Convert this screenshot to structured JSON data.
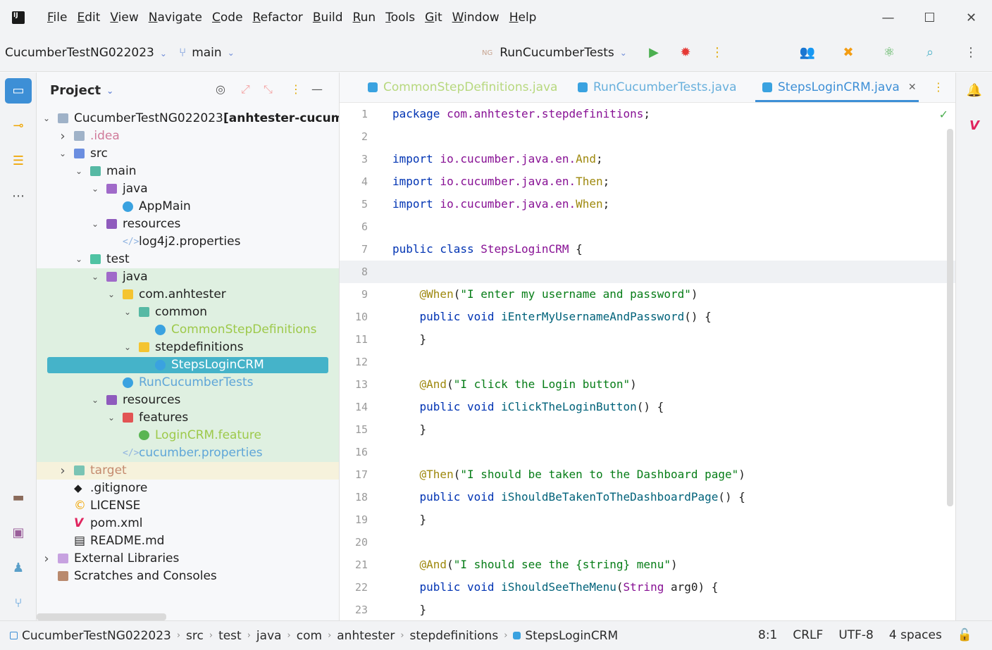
{
  "app": {
    "menu": [
      "File",
      "Edit",
      "View",
      "Navigate",
      "Code",
      "Refactor",
      "Build",
      "Run",
      "Tools",
      "Git",
      "Window",
      "Help"
    ],
    "window_controls": {
      "minimize": "—",
      "maximize": "☐",
      "close": "✕"
    }
  },
  "toolbar": {
    "project_name": "CucumberTestNG022023",
    "branch": "main",
    "run_config": "RunCucumberTests",
    "run_config_badge": "NG"
  },
  "project_panel": {
    "title": "Project",
    "tree": [
      {
        "label": "CucumberTestNG022023",
        "suffix": "[anhtester-cucum",
        "depth": 0,
        "arrow": "down",
        "icon": "folder",
        "style": ""
      },
      {
        "label": ".idea",
        "depth": 1,
        "arrow": "right",
        "icon": "folder",
        "style": "pink"
      },
      {
        "label": "src",
        "depth": 1,
        "arrow": "down",
        "icon": "folder-src",
        "style": ""
      },
      {
        "label": "main",
        "depth": 2,
        "arrow": "down",
        "icon": "folder-main",
        "style": ""
      },
      {
        "label": "java",
        "depth": 3,
        "arrow": "down",
        "icon": "folder-java",
        "style": ""
      },
      {
        "label": "AppMain",
        "depth": 4,
        "arrow": "",
        "icon": "class",
        "style": ""
      },
      {
        "label": "resources",
        "depth": 3,
        "arrow": "down",
        "icon": "folder-res",
        "style": ""
      },
      {
        "label": "log4j2.properties",
        "depth": 4,
        "arrow": "",
        "icon": "xml",
        "style": ""
      },
      {
        "label": "test",
        "depth": 2,
        "arrow": "down",
        "icon": "folder-test",
        "style": ""
      },
      {
        "label": "java",
        "depth": 3,
        "arrow": "down",
        "icon": "folder-java",
        "style": "",
        "bg": "green"
      },
      {
        "label": "com.anhtester",
        "depth": 4,
        "arrow": "down",
        "icon": "folder-pkg",
        "style": "",
        "bg": "green"
      },
      {
        "label": "common",
        "depth": 5,
        "arrow": "down",
        "icon": "folder-main",
        "style": "",
        "bg": "green"
      },
      {
        "label": "CommonStepDefinitions",
        "depth": 6,
        "arrow": "",
        "icon": "class",
        "style": "green",
        "bg": "green"
      },
      {
        "label": "stepdefinitions",
        "depth": 5,
        "arrow": "down",
        "icon": "folder-pkg",
        "style": "",
        "bg": "green"
      },
      {
        "label": "StepsLoginCRM",
        "depth": 6,
        "arrow": "",
        "icon": "class",
        "style": "",
        "bg": "green",
        "selected": true
      },
      {
        "label": "RunCucumberTests",
        "depth": 4,
        "arrow": "",
        "icon": "class",
        "style": "blue",
        "bg": "green"
      },
      {
        "label": "resources",
        "depth": 3,
        "arrow": "down",
        "icon": "folder-res",
        "style": "",
        "bg": "green"
      },
      {
        "label": "features",
        "depth": 4,
        "arrow": "down",
        "icon": "folder-feat",
        "style": "",
        "bg": "green"
      },
      {
        "label": "LoginCRM.feature",
        "depth": 5,
        "arrow": "",
        "icon": "cuke",
        "style": "green",
        "bg": "green"
      },
      {
        "label": "cucumber.properties",
        "depth": 4,
        "arrow": "",
        "icon": "xml",
        "style": "blue",
        "bg": "green"
      },
      {
        "label": "target",
        "depth": 1,
        "arrow": "right",
        "icon": "folder-target",
        "style": "target",
        "bg": "yellow"
      },
      {
        "label": ".gitignore",
        "depth": 1,
        "arrow": "",
        "icon": "git",
        "style": ""
      },
      {
        "label": "LICENSE",
        "depth": 1,
        "arrow": "",
        "icon": "license",
        "style": ""
      },
      {
        "label": "pom.xml",
        "depth": 1,
        "arrow": "",
        "icon": "maven",
        "style": ""
      },
      {
        "label": "README.md",
        "depth": 1,
        "arrow": "",
        "icon": "md",
        "style": ""
      },
      {
        "label": "External Libraries",
        "depth": 0,
        "arrow": "right",
        "icon": "folder-lib",
        "style": ""
      },
      {
        "label": "Scratches and Consoles",
        "depth": 0,
        "arrow": "",
        "icon": "scratch",
        "style": ""
      }
    ]
  },
  "editor": {
    "tabs": [
      {
        "label": "CommonStepDefinitions.java",
        "active": false
      },
      {
        "label": "RunCucumberTests.java",
        "active": false
      },
      {
        "label": "StepsLoginCRM.java",
        "active": true
      }
    ],
    "line_numbers": [
      "1",
      "2",
      "3",
      "4",
      "5",
      "6",
      "7",
      "8",
      "9",
      "10",
      "11",
      "12",
      "13",
      "14",
      "15",
      "16",
      "17",
      "18",
      "19",
      "20",
      "21",
      "22",
      "23"
    ],
    "code_lines": [
      [
        [
          "kw",
          "package "
        ],
        [
          "pkg",
          "com.anhtester.stepdefinitions"
        ],
        [
          "",
          "; "
        ]
      ],
      [],
      [
        [
          "kw",
          "import "
        ],
        [
          "pkg",
          "io.cucumber.java.en."
        ],
        [
          "ann",
          "And"
        ],
        [
          "",
          ";"
        ]
      ],
      [
        [
          "kw",
          "import "
        ],
        [
          "pkg",
          "io.cucumber.java.en."
        ],
        [
          "ann",
          "Then"
        ],
        [
          "",
          ";"
        ]
      ],
      [
        [
          "kw",
          "import "
        ],
        [
          "pkg",
          "io.cucumber.java.en."
        ],
        [
          "ann",
          "When"
        ],
        [
          "",
          ";"
        ]
      ],
      [],
      [
        [
          "kw",
          "public class "
        ],
        [
          "pkg",
          "StepsLoginCRM"
        ],
        [
          "",
          " {"
        ]
      ],
      [],
      [
        [
          "",
          "    "
        ],
        [
          "ann",
          "@When"
        ],
        [
          "",
          "("
        ],
        [
          "str",
          "\"I enter my username and password\""
        ],
        [
          "",
          ")"
        ]
      ],
      [
        [
          "",
          "    "
        ],
        [
          "kw",
          "public void "
        ],
        [
          "mth",
          "iEnterMyUsernameAndPassword"
        ],
        [
          "",
          "() {"
        ]
      ],
      [
        [
          "",
          "    }"
        ]
      ],
      [],
      [
        [
          "",
          "    "
        ],
        [
          "ann",
          "@And"
        ],
        [
          "",
          "("
        ],
        [
          "str",
          "\"I click the Login button\""
        ],
        [
          "",
          ")"
        ]
      ],
      [
        [
          "",
          "    "
        ],
        [
          "kw",
          "public void "
        ],
        [
          "mth",
          "iClickTheLoginButton"
        ],
        [
          "",
          "() {"
        ]
      ],
      [
        [
          "",
          "    }"
        ]
      ],
      [],
      [
        [
          "",
          "    "
        ],
        [
          "ann",
          "@Then"
        ],
        [
          "",
          "("
        ],
        [
          "str",
          "\"I should be taken to the Dashboard page\""
        ],
        [
          "",
          ")"
        ]
      ],
      [
        [
          "",
          "    "
        ],
        [
          "kw",
          "public void "
        ],
        [
          "mth",
          "iShouldBeTakenToTheDashboardPage"
        ],
        [
          "",
          "() {"
        ]
      ],
      [
        [
          "",
          "    }"
        ]
      ],
      [],
      [
        [
          "",
          "    "
        ],
        [
          "ann",
          "@And"
        ],
        [
          "",
          "("
        ],
        [
          "str",
          "\"I should see the {string} menu\""
        ],
        [
          "",
          ")"
        ]
      ],
      [
        [
          "",
          "    "
        ],
        [
          "kw",
          "public void "
        ],
        [
          "mth",
          "iShouldSeeTheMenu"
        ],
        [
          "",
          "("
        ],
        [
          "pkg",
          "String"
        ],
        [
          "",
          " arg0) {"
        ]
      ],
      [
        [
          "",
          "    }"
        ]
      ]
    ]
  },
  "statusbar": {
    "breadcrumbs": [
      "CucumberTestNG022023",
      "src",
      "test",
      "java",
      "com",
      "anhtester",
      "stepdefinitions",
      "StepsLoginCRM"
    ],
    "position": "8:1",
    "line_ending": "CRLF",
    "encoding": "UTF-8",
    "indent": "4 spaces"
  },
  "colors": {
    "accent": "#3d8fd6",
    "selection": "#45b3c9",
    "test_bg": "#dff0e1",
    "excluded_bg": "#f6f2dc"
  }
}
